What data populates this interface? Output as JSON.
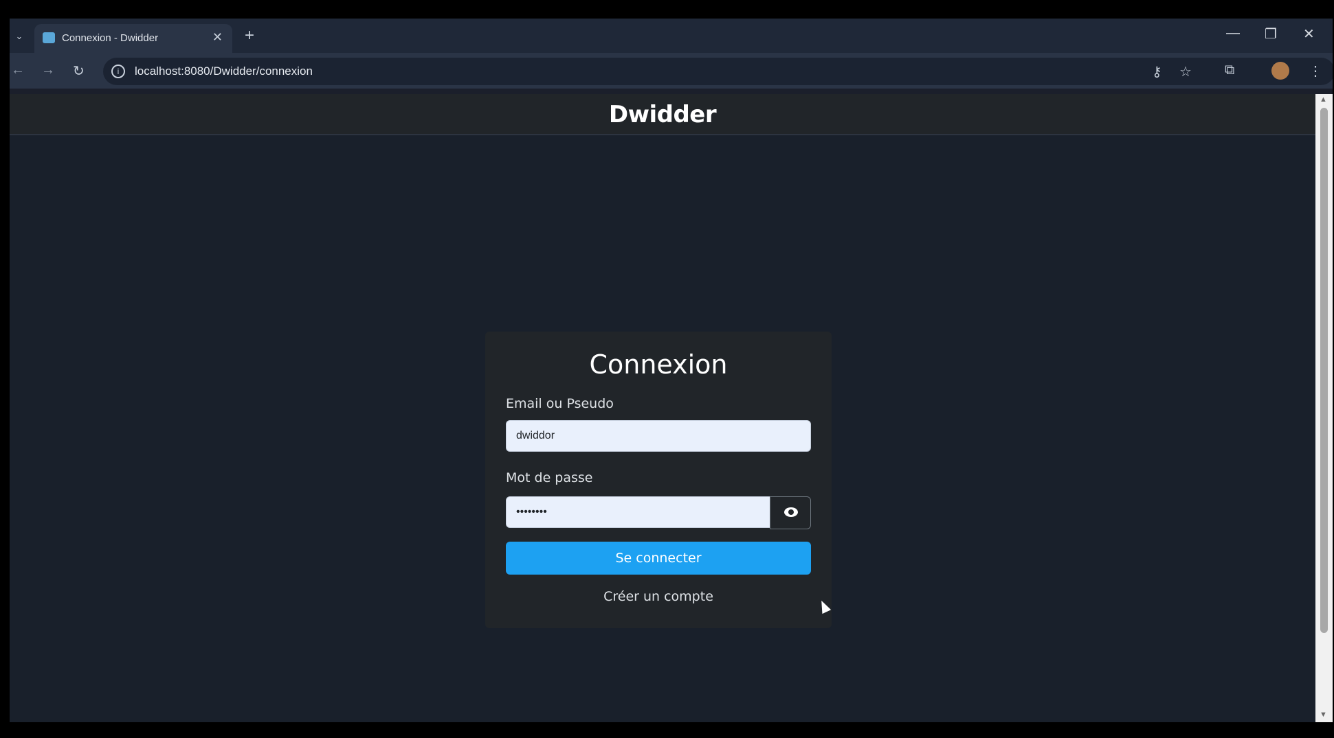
{
  "browser": {
    "tab_title": "Connexion - Dwidder",
    "new_tab_symbol": "+",
    "close_symbol": "✕",
    "url": "localhost:8080/Dwidder/connexion"
  },
  "site": {
    "brand": "Dwidder"
  },
  "login": {
    "heading": "Connexion",
    "identifier_label": "Email ou Pseudo",
    "identifier_value": "dwiddor",
    "password_label": "Mot de passe",
    "password_value": "••••••••",
    "submit_label": "Se connecter",
    "create_account_label": "Créer un compte"
  },
  "colors": {
    "accent": "#1da1f2",
    "page_bg": "#19202b",
    "card_bg": "#212529"
  }
}
